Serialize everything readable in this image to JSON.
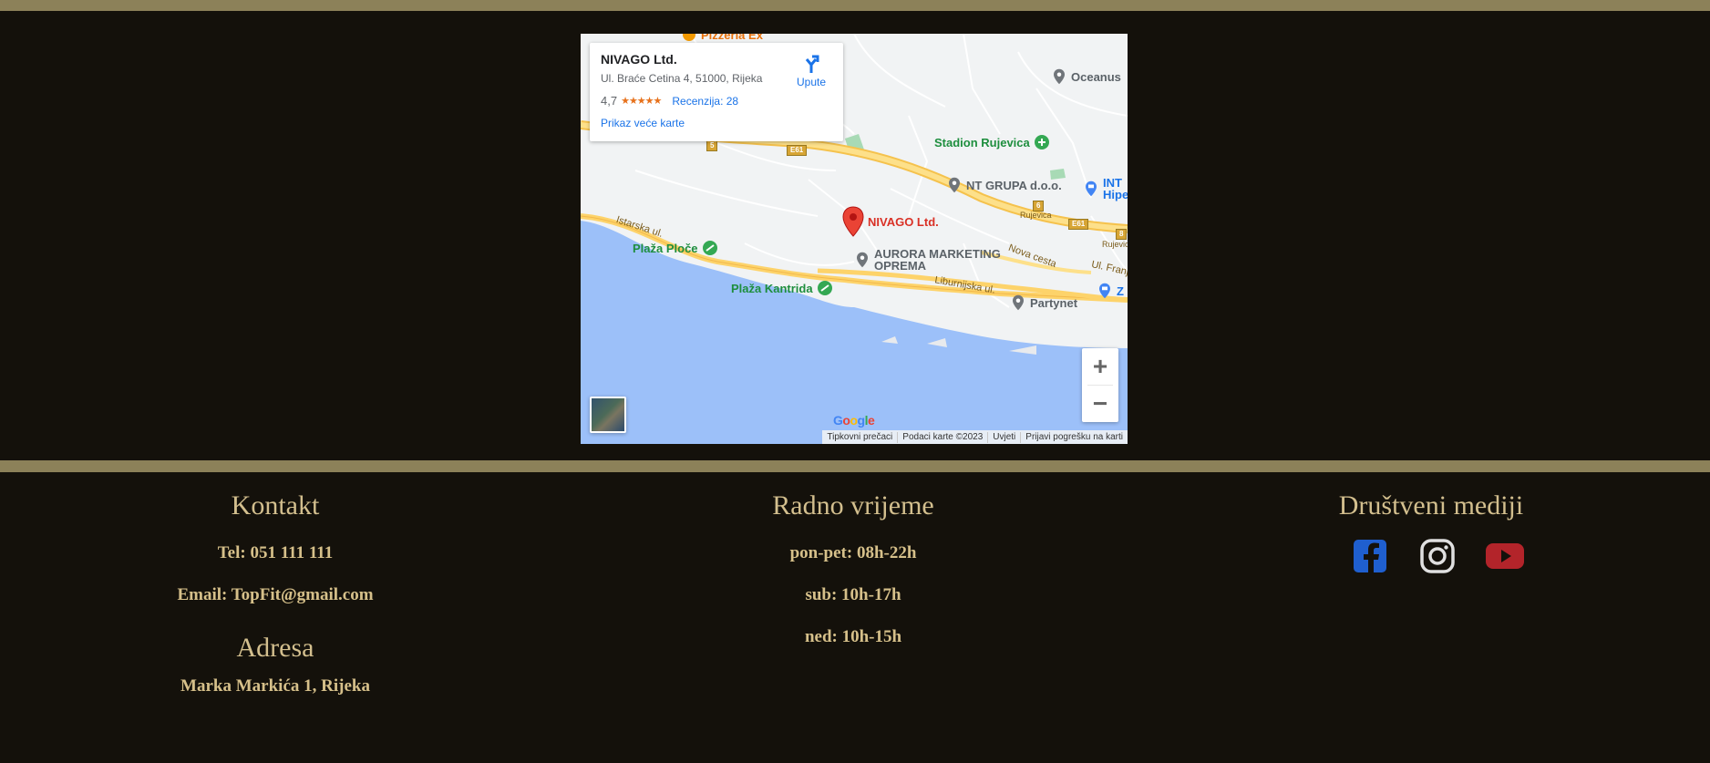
{
  "map": {
    "info_card": {
      "title": "NIVAGO Ltd.",
      "address": "Ul. Braće Cetina 4, 51000, Rijeka",
      "rating": "4,7",
      "stars": "★★★★★",
      "reviews": "Recenzija: 28",
      "bigger_map_link": "Prikaz veće karte",
      "directions_label": "Upute"
    },
    "places": {
      "top_cut": "Pizzeria Ex",
      "oceanus": "Oceanus",
      "stadion": "Stadion Rujevica",
      "nt_grupa": "NT GRUPA d.o.o.",
      "inter": "INT",
      "hipe": "Hipe",
      "nivago": "NIVAGO Ltd.",
      "aurora_1": "AURORA MARKETING",
      "aurora_2": "OPREMA",
      "plaza_ploce": "Plaža Ploče",
      "plaza_kantrida": "Plaža Kantrida",
      "partynet": "Partynet",
      "z_cut": "Z"
    },
    "road_labels": {
      "istarska": "Istarska ul.",
      "nova_cesta": "Nova cesta",
      "ul_franje": "Ul. Franje",
      "liburnijska": "Liburnijska ul.",
      "rujevica": "Rujevica",
      "rujevica_2": "Rujevic"
    },
    "shields": {
      "e61_a": "E61",
      "e61_b": "E61",
      "r5": "5",
      "r6": "6",
      "r8": "8"
    },
    "zoom_in": "+",
    "zoom_out": "−",
    "google_logo": "Google",
    "attribution": {
      "shortcuts": "Tipkovni prečaci",
      "map_data": "Podaci karte ©2023",
      "terms": "Uvjeti",
      "report": "Prijavi pogrešku na karti"
    }
  },
  "footer": {
    "contact": {
      "heading": "Kontakt",
      "phone": "Tel: 051 111 111",
      "email": "Email: TopFit@gmail.com",
      "address_heading": "Adresa",
      "address": "Marka Markića 1, Rijeka"
    },
    "hours": {
      "heading": "Radno vrijeme",
      "weekdays": "pon-pet: 08h-22h",
      "saturday": "sub: 10h-17h",
      "sunday": "ned: 10h-15h"
    },
    "social": {
      "heading": "Društveni mediji",
      "icons": [
        "facebook-icon",
        "instagram-icon",
        "youtube-icon"
      ],
      "colors": {
        "facebook": "#1f5fcf",
        "instagram": "#e0e0e0",
        "youtube": "#b3242a"
      }
    }
  },
  "colors": {
    "background": "#14110b",
    "rule": "#8c8159",
    "heading": "#d3bf8e",
    "text": "#d6c08a"
  }
}
